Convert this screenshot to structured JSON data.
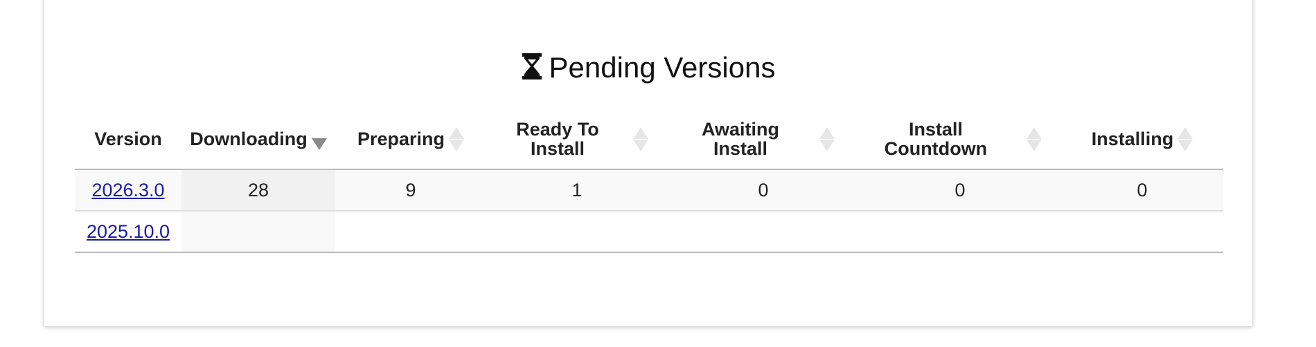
{
  "section": {
    "title": "Pending Versions",
    "icon": "hourglass-icon"
  },
  "table": {
    "columns": [
      {
        "label": "Version",
        "sortable": false
      },
      {
        "label": "Downloading",
        "sortable": true,
        "sort_state": "descending"
      },
      {
        "label": "Preparing",
        "sortable": true,
        "sort_state": "none"
      },
      {
        "label": "Ready To Install",
        "sortable": true,
        "sort_state": "none"
      },
      {
        "label": "Awaiting Install",
        "sortable": true,
        "sort_state": "none"
      },
      {
        "label": "Install Countdown",
        "sortable": true,
        "sort_state": "none"
      },
      {
        "label": "Installing",
        "sortable": true,
        "sort_state": "none"
      }
    ],
    "rows": [
      {
        "version": "2026.3.0",
        "cells": [
          "28",
          "9",
          "1",
          "0",
          "0",
          "0"
        ]
      },
      {
        "version": "2025.10.0",
        "cells": [
          "",
          "",
          "",
          "",
          "",
          ""
        ]
      }
    ]
  },
  "colors": {
    "link": "#1a1aa6",
    "sort_active": "#8a8a8a",
    "sort_inactive": "#e6e6e6"
  }
}
